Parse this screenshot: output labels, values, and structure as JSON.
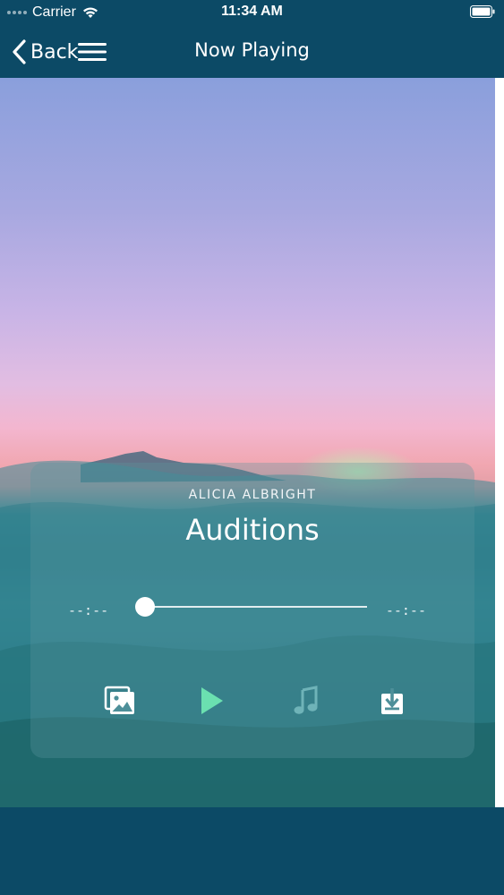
{
  "status_bar": {
    "carrier": "Carrier",
    "time": "11:34 AM",
    "wifi_icon": "wifi-icon",
    "battery_icon": "battery-icon"
  },
  "nav_bar": {
    "back_label": "Back",
    "title": "Now Playing",
    "menu_icon": "hamburger-menu-icon",
    "back_icon": "chevron-left-icon"
  },
  "player": {
    "artist": "ALICIA ALBRIGHT",
    "title": "Auditions",
    "time_elapsed": "--:--",
    "time_remaining": "--:--",
    "progress": 0,
    "controls": [
      {
        "name": "gallery",
        "icon": "photos-icon"
      },
      {
        "name": "play",
        "icon": "play-icon"
      },
      {
        "name": "music",
        "icon": "music-note-icon"
      },
      {
        "name": "download",
        "icon": "download-icon"
      }
    ]
  },
  "colors": {
    "bar_background": "#0c4a66",
    "play_accent": "#6be0b0",
    "music_icon_muted": "#6fb3b8"
  }
}
